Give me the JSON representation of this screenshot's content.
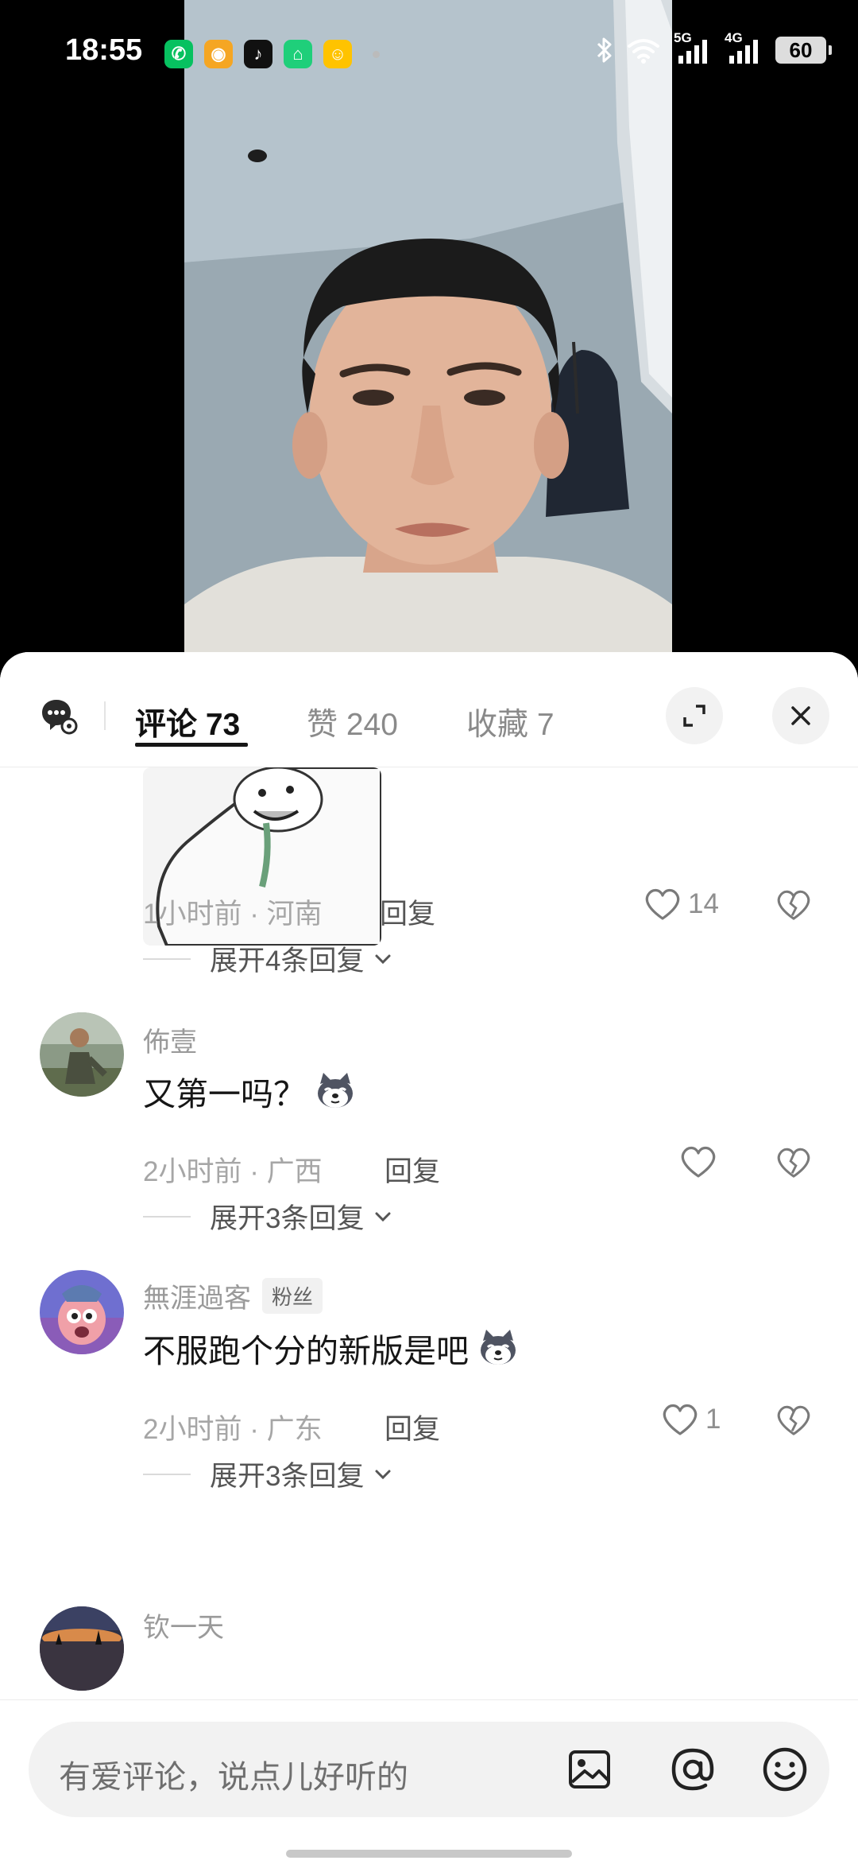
{
  "status_bar": {
    "time": "18:55",
    "apps": [
      {
        "name": "wechat-icon",
        "glyph": "✆",
        "color": "#07c160"
      },
      {
        "name": "weibo-icon",
        "glyph": "◉",
        "color": "#f5a623"
      },
      {
        "name": "tiktok-icon",
        "glyph": "♪",
        "color": "#111111"
      },
      {
        "name": "mijia-icon",
        "glyph": "⌂",
        "color": "#1fcf7a"
      },
      {
        "name": "meituan-icon",
        "glyph": "☺",
        "color": "#ffc300"
      }
    ],
    "network_1": "5G",
    "network_2": "4G",
    "battery": "60"
  },
  "panel": {
    "tabs": [
      {
        "label": "评论 73"
      },
      {
        "label": "赞 240"
      },
      {
        "label": "收藏 7"
      }
    ]
  },
  "comments": [
    {
      "meta": "1小时前 · 河南",
      "reply": "回复",
      "likes": "14",
      "expand": "展开4条回复"
    },
    {
      "user": "佈壹",
      "text": "又第一吗？",
      "meta": "2小时前 · 广西",
      "reply": "回复",
      "likes": "",
      "expand": "展开3条回复"
    },
    {
      "user": "無涯過客",
      "badge": "粉丝",
      "text": "不服跑个分的新版是吧",
      "meta": "2小时前 · 广东",
      "reply": "回复",
      "likes": "1",
      "expand": "展开3条回复"
    },
    {
      "user": "钦一天"
    }
  ],
  "input": {
    "placeholder": "有爱评论，说点儿好听的"
  },
  "colors": {
    "accent_text": "#161616",
    "muted_text": "#a6a6a6",
    "panel_bg": "#ffffff"
  }
}
